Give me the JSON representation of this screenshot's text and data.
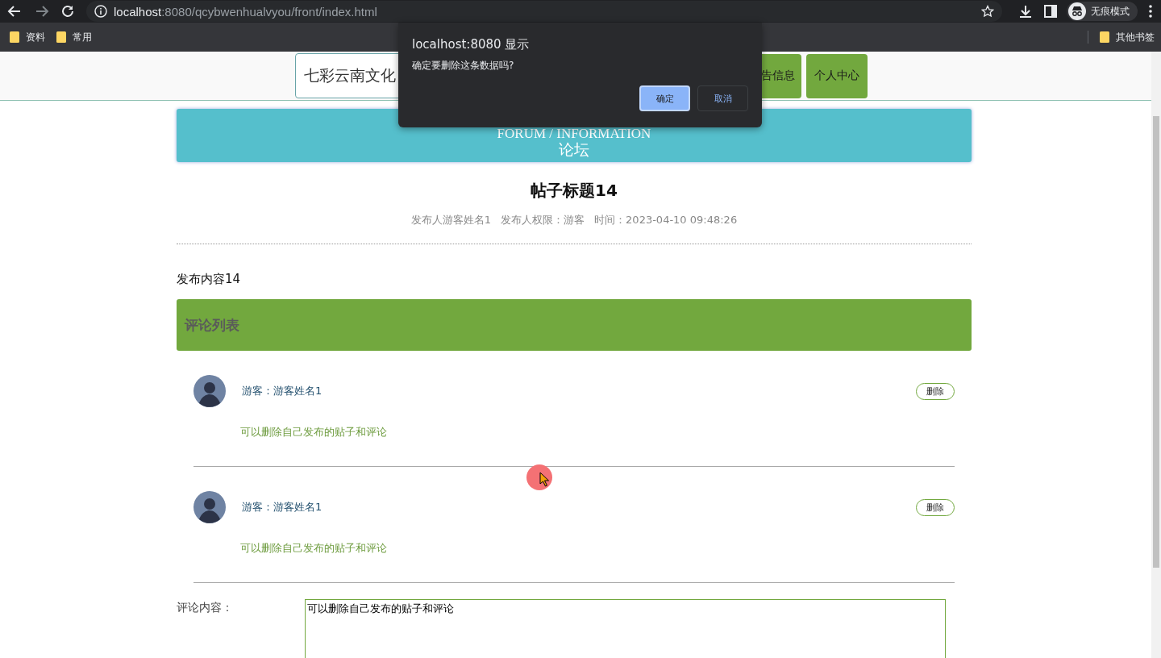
{
  "browser": {
    "url_host": "localhost",
    "url_rest": ":8080/qcybwenhualvyou/front/index.html",
    "incognito_label": "无痕模式",
    "bookmarks": [
      "资料",
      "常用"
    ],
    "other_bookmarks": "其他书签"
  },
  "dialog": {
    "title": "localhost:8080 显示",
    "message": "确定要删除这条数据吗?",
    "buttons": [
      {
        "label": "确定",
        "selected": true
      },
      {
        "label": "取消",
        "selected": false
      }
    ]
  },
  "nav": {
    "site_title": "七彩云南文化",
    "buttons": [
      "告信息",
      "个人中心"
    ]
  },
  "banner": {
    "subtitle": "FORUM / INFORMATION",
    "title": "论坛"
  },
  "post": {
    "title": "帖子标题14",
    "meta": [
      "发布人游客姓名1",
      "发布人权限：游客",
      "时间：2023-04-10 09:48:26"
    ],
    "content": "发布内容14"
  },
  "comments_header": "评论列表",
  "comments": [
    {
      "author": "游客：游客姓名1",
      "text": "可以删除自己发布的贴子和评论",
      "delete_label": "删除"
    },
    {
      "author": "游客：游客姓名1",
      "text": "可以删除自己发布的贴子和评论",
      "delete_label": "删除"
    }
  ],
  "comment_form": {
    "label": "评论内容：",
    "value": "可以删除自己发布的贴子和评论"
  }
}
